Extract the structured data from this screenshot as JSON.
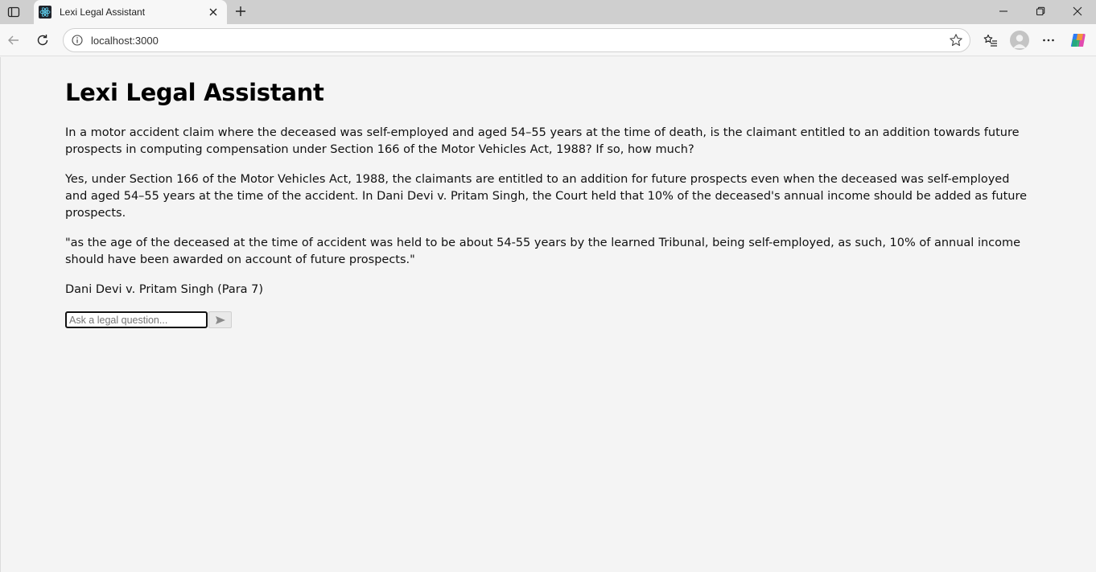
{
  "browser": {
    "tab_title": "Lexi Legal Assistant",
    "address": "localhost:3000",
    "icons": {
      "tab_actions": "tab-actions-icon",
      "favicon": "react-logo-icon",
      "tab_close": "close-icon",
      "new_tab": "plus-icon",
      "minimize": "minimize-icon",
      "restore": "restore-icon",
      "close_window": "close-icon",
      "back": "arrow-left-icon",
      "reload": "reload-icon",
      "info": "info-icon",
      "favorite": "star-icon",
      "favorites": "favorites-list-icon",
      "profile": "avatar",
      "more": "more-icon",
      "copilot": "copilot-icon"
    }
  },
  "app": {
    "title": "Lexi Legal Assistant",
    "question": "In a motor accident claim where the deceased was self-employed and aged 54–55 years at the time of death, is the claimant entitled to an addition towards future prospects in computing compensation under Section 166 of the Motor Vehicles Act, 1988? If so, how much?",
    "answer": "Yes, under Section 166 of the Motor Vehicles Act, 1988, the claimants are entitled to an addition for future prospects even when the deceased was self-employed and aged 54–55 years at the time of the accident. In Dani Devi v. Pritam Singh, the Court held that 10% of the deceased's annual income should be added as future prospects.",
    "quote": "\"as the age of the deceased at the time of accident was held to be about 54-55 years by the learned Tribunal, being self-employed, as such, 10% of annual income should have been awarded on account of future prospects.\"",
    "citation": "Dani Devi v. Pritam Singh (Para 7)",
    "input": {
      "placeholder": "Ask a legal question...",
      "value": ""
    },
    "send_icon": "send-icon"
  },
  "colors": {
    "tabstrip": "#cfcfcf",
    "toolbar": "#f7f7f7",
    "page_bg": "#f4f4f4",
    "text": "#111111"
  }
}
